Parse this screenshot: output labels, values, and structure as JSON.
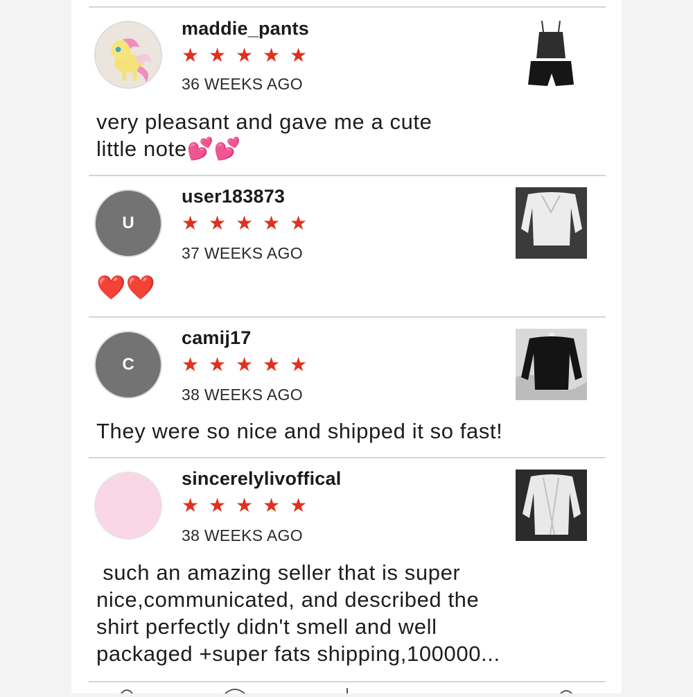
{
  "reviews": [
    {
      "username": "maddie_pants",
      "avatar": {
        "type": "photo",
        "icon": "pony-figure-photo"
      },
      "rating": 5,
      "time": "36 WEEKS AGO",
      "text": "very pleasant and gave me a cute\nlittle note💕💕",
      "item_image": "black-cami-and-shorts-set"
    },
    {
      "username": "user183873",
      "avatar": {
        "type": "letter",
        "letter": "U"
      },
      "rating": 5,
      "time": "37 WEEKS AGO",
      "text": "❤️❤️",
      "item_image": "white-long-sleeve-top"
    },
    {
      "username": "camij17",
      "avatar": {
        "type": "letter",
        "letter": "C"
      },
      "rating": 5,
      "time": "38 WEEKS AGO",
      "text": "They were so nice and shipped it so fast!",
      "item_image": "black-long-sleeve-top"
    },
    {
      "username": "sincerelylivoffical",
      "avatar": {
        "type": "blank"
      },
      "rating": 5,
      "time": "38 WEEKS AGO",
      "text": " such an amazing seller that is super\nnice,communicated, and described the\nshirt perfectly didn't smell and well\npackaged +super fats shipping,100000...",
      "item_image": "white-ribbed-cardigan"
    }
  ],
  "star_glyph": "★",
  "colors": {
    "star": "#e0301e",
    "avatar_letter_bg": "#737373",
    "avatar_pink": "#fbd6e6",
    "divider": "#d4d4d4"
  }
}
